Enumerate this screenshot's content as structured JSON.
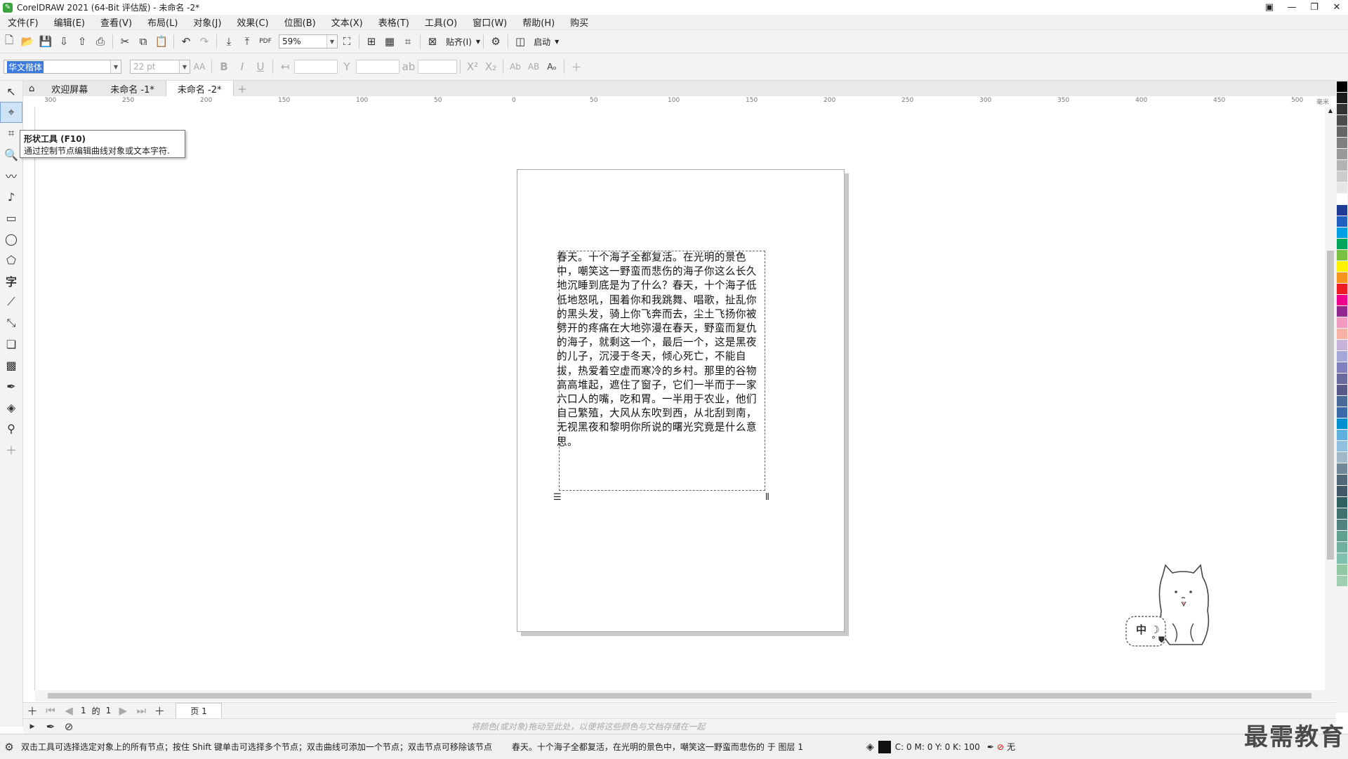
{
  "window": {
    "title": "CorelDRAW 2021 (64-Bit 评估版) - 未命名 -2*"
  },
  "menu": [
    "文件(F)",
    "编辑(E)",
    "查看(V)",
    "布局(L)",
    "对象(J)",
    "效果(C)",
    "位图(B)",
    "文本(X)",
    "表格(T)",
    "工具(O)",
    "窗口(W)",
    "帮助(H)",
    "购买"
  ],
  "toolbar": {
    "zoom": "59%",
    "snap_label": "贴齐(I)",
    "launch_label": "启动"
  },
  "propbar": {
    "font_name": "华文楷体",
    "font_size": "22 pt"
  },
  "tabs": [
    {
      "label": "欢迎屏幕"
    },
    {
      "label": "未命名 -1*"
    },
    {
      "label": "未命名 -2*"
    }
  ],
  "ruler": {
    "h_ticks": [
      "300",
      "250",
      "200",
      "150",
      "100",
      "50",
      "0",
      "50",
      "100",
      "150",
      "200",
      "250",
      "300",
      "350",
      "400",
      "450",
      "500"
    ],
    "unit": "毫米"
  },
  "tooltip": {
    "title": "形状工具 (F10)",
    "desc": "通过控制节点编辑曲线对象或文本字符."
  },
  "document": {
    "text": "春天。十个海子全都复活。在光明的景色中，嘲笑这一野蛮而悲伤的海子你这么长久地沉睡到底是为了什么？春天，十个海子低低地怒吼，围着你和我跳舞、唱歌，扯乱你的黑头发，骑上你飞奔而去，尘土飞扬你被劈开的疼痛在大地弥漫在春天，野蛮而复仇的海子，就剩这一个，最后一个，这是黑夜的儿子，沉浸于冬天，倾心死亡，不能自拔，热爱着空虚而寒冷的乡村。那里的谷物高高堆起，遮住了窗子，它们一半而于一家六口人的嘴，吃和胃。一半用于农业，他们自己繁殖，大风从东吹到西，从北刮到南，无视黑夜和黎明你所说的曙光究竟是什么意思。"
  },
  "pagenav": {
    "page_index": "1",
    "of_label": "的",
    "page_total": "1",
    "page_tab": "页 1"
  },
  "colordock": {
    "hint": "将颜色(或对象)拖动至此处，以便将这些颜色与文档存储在一起"
  },
  "status": {
    "hint": "双击工具可选择选定对象上的所有节点；按住 Shift 键单击可选择多个节点；双击曲线可添加一个节点；双击节点可移除该节点",
    "selection": "春天。十个海子全都复活，在光明的景色中，嘲笑这一野蛮而悲伤的 于 图层 1",
    "fill": "C: 0 M: 0 Y: 0 K: 100",
    "outline": "无"
  },
  "ime": {
    "label": "中"
  },
  "watermark": {
    "text": "最需教育"
  },
  "palette": [
    "#000000",
    "#1a1a1a",
    "#333333",
    "#4d4d4d",
    "#666666",
    "#808080",
    "#999999",
    "#b3b3b3",
    "#cccccc",
    "#e6e6e6",
    "#ffffff",
    "#1e3c96",
    "#1f5fbf",
    "#00a0e6",
    "#00a65a",
    "#7ac143",
    "#fff200",
    "#f7941d",
    "#ed1c24",
    "#ec008c",
    "#92278f",
    "#f49ac1",
    "#f7b2a5",
    "#c7b3d9",
    "#a6a6d9",
    "#8080c0",
    "#6a6aa0",
    "#5a5a8a",
    "#4a6a9a",
    "#3a6aaa",
    "#0090d0",
    "#60b0e0",
    "#90c0e0",
    "#a0b8c8",
    "#708898",
    "#506878",
    "#405868",
    "#306060",
    "#407070",
    "#508080",
    "#60a090",
    "#70b0a0",
    "#80c0b0",
    "#90c8a0",
    "#a0d0b0"
  ]
}
